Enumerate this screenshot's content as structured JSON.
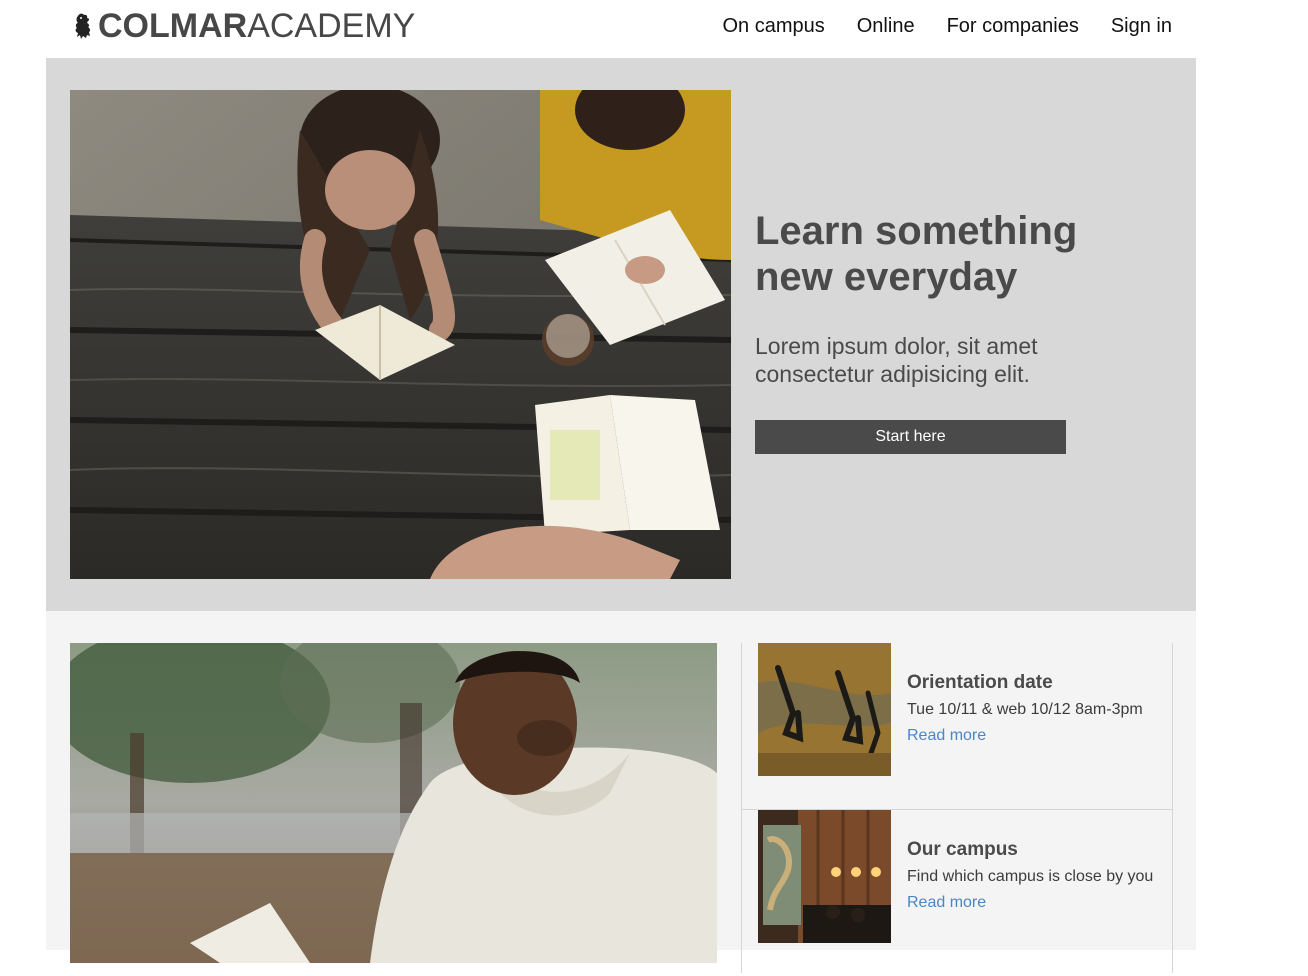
{
  "header": {
    "logo_bold": "COLMAR",
    "logo_light": "ACADEMY",
    "logo_icon": "lion-icon",
    "nav": [
      {
        "label": "On campus"
      },
      {
        "label": "Online"
      },
      {
        "label": "For companies"
      },
      {
        "label": "Sign in"
      }
    ]
  },
  "hero": {
    "image_subject": "Students reading and writing at a wooden picnic table",
    "title": "Learn something new everyday",
    "subtitle": "Lorem ipsum dolor, sit amet consectetur adipisicing elit.",
    "cta_label": "Start here"
  },
  "feature": {
    "image_subject": "Smiling man in a sweater reading outdoors"
  },
  "news": [
    {
      "title": "Orientation date",
      "description": "Tue 10/11 & web 10/12 8am-3pm",
      "link": "Read more",
      "thumb_subject": "Shadows of people walking on grass"
    },
    {
      "title": "Our campus",
      "description": "Find which campus is close by you",
      "link": "Read more",
      "thumb_subject": "Classroom interior with a wall map"
    }
  ],
  "colors": {
    "hero_bg": "#d8d8d8",
    "lower_bg": "#f3f4f3",
    "text_dark": "#4a4a4a",
    "button_bg": "#4a4a4a",
    "link": "#4a86c8"
  }
}
